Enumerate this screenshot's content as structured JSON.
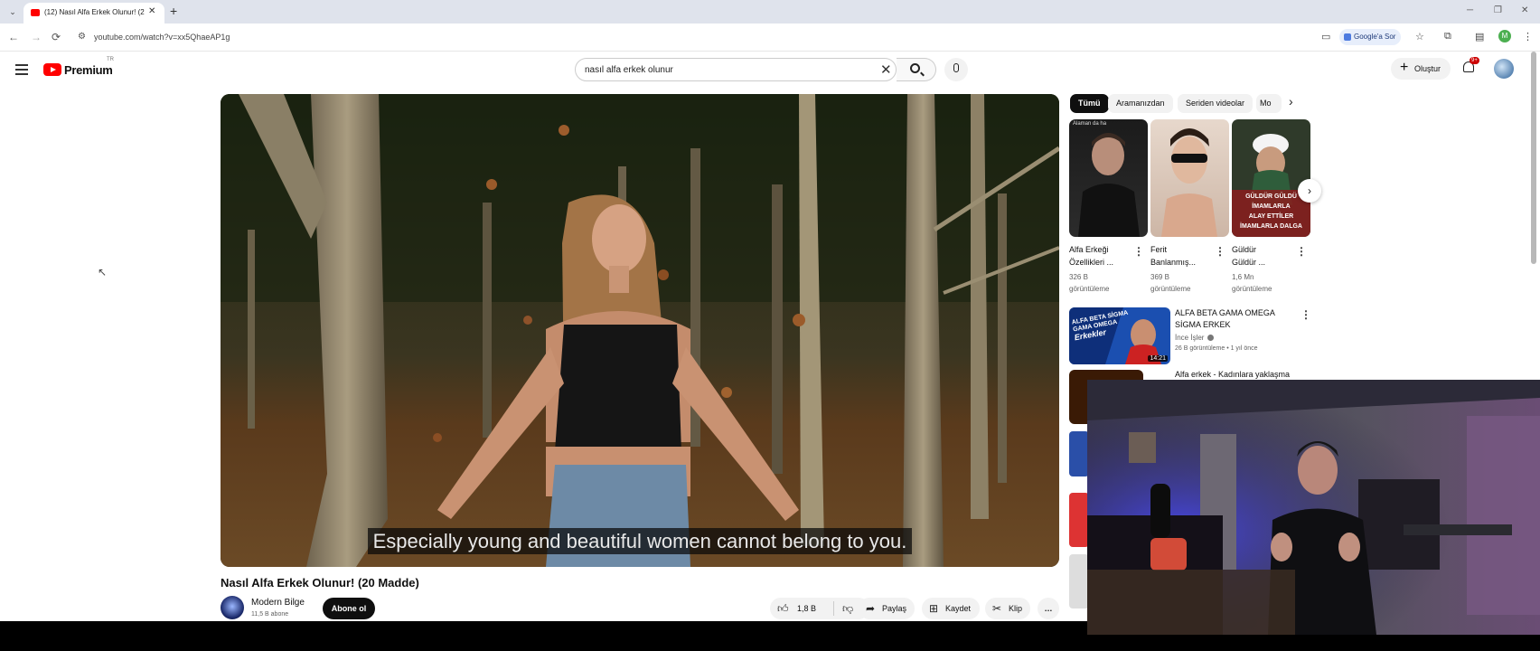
{
  "browser": {
    "tab_title": "(12) Nasıl Alfa Erkek Olunur! (2",
    "url": "youtube.com/watch?v=xx5QhaeAP1g",
    "google_btn": "Google'a Sor",
    "profile_letter": "M"
  },
  "header": {
    "logo": "Premium",
    "logo_country": "TR",
    "search_value": "nasıl alfa erkek olunur",
    "create_label": "Oluştur",
    "notif_count": "9+"
  },
  "video": {
    "caption": "Especially young and beautiful women cannot belong to you.",
    "title": "Nasıl Alfa Erkek Olunur! (20 Madde)",
    "channel": "Modern Bilge",
    "subs": "11,5 B abone",
    "subscribe_label": "Abone ol",
    "likes": "1,8 B",
    "share_label": "Paylaş",
    "save_label": "Kaydet",
    "clip_label": "Klip",
    "more_label": "…"
  },
  "sidebar": {
    "chips": [
      "Tümü",
      "Aramanızdan",
      "Seriden videolar",
      "Mo"
    ],
    "shorts": [
      {
        "title_l1": "Alfa Erkeği",
        "title_l2": "Özellikleri ...",
        "views_l1": "326 B",
        "views_l2": "görüntüleme"
      },
      {
        "title_l1": "Ferit",
        "title_l2": "Banlanmış...",
        "views_l1": "369 B",
        "views_l2": "görüntüleme"
      },
      {
        "title_l1": "Güldür",
        "title_l2": "Güldür ...",
        "views_l1": "1,6 Mn",
        "views_l2": "görüntüleme"
      }
    ],
    "short3_overlay_l1": "GÜLDÜR GÜLDÜ",
    "short3_overlay_l2": "İMAMLARLA",
    "short3_overlay_l3": "ALAY ETTİLER",
    "short3_overlay_l4": "İMAMLARLA DALGA",
    "short1_overlay": "Alaman da ha",
    "rec": {
      "title": "ALFA BETA GAMA OMEGA SİGMA ERKEK",
      "channel": "İnce İşler",
      "meta": "26 B görüntüleme • 1 yıl önce",
      "duration": "14:21",
      "thumb_text_l1": "ALFA BETA SİGMA",
      "thumb_text_l2": "GAMA OMEGA",
      "thumb_text_l3": "Erkekler"
    },
    "rec2_title": "Alfa erkek - Kadınlara yaklaşma"
  },
  "colors": {
    "brand_red": "#ff0000",
    "chip_active": "#0f0f0f",
    "chip_bg": "#f2f2f2"
  }
}
